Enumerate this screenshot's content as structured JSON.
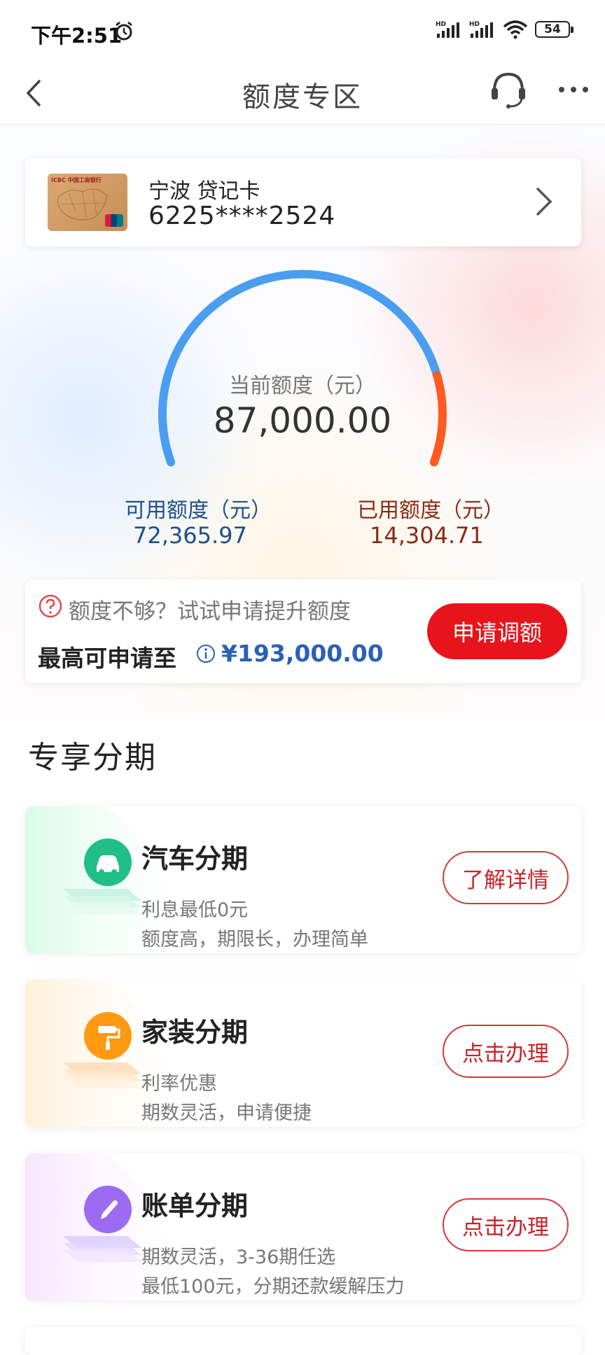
{
  "status_bar": {
    "time": "下午2:51",
    "battery": "54",
    "signal1": "HD",
    "signal2": "HD"
  },
  "nav": {
    "title": "额度专区"
  },
  "card": {
    "name": "宁波 贷记卡",
    "number": "6225****2524",
    "thumb_text": "ICBC 中国工商银行"
  },
  "gauge": {
    "label": "当前额度（元）",
    "total": "87,000.00",
    "available_label": "可用额度（元）",
    "available_value": "72,365.97",
    "used_label": "已用额度（元）",
    "used_value": "14,304.71",
    "used_fraction": 0.1644,
    "color_available": "#4a9ef0",
    "color_used": "#ff5a1f"
  },
  "raise": {
    "hint": "额度不够？试试申请提升额度",
    "max_label": "最高可申请至",
    "max_value": "¥193,000.00",
    "button": "申请调额",
    "button_color": "#e8141b"
  },
  "section_title": "专享分期",
  "promos": [
    {
      "title": "汽车分期",
      "line1": "利息最低0元",
      "line2": "额度高，期限长，办理简单",
      "button": "了解详情",
      "icon": "car-icon",
      "accent": "#1fbf85"
    },
    {
      "title": "家装分期",
      "line1": "利率优惠",
      "line2": "期数灵活，申请便捷",
      "button": "点击办理",
      "icon": "paint-roller-icon",
      "accent": "#ff9a10"
    },
    {
      "title": "账单分期",
      "line1": "期数灵活，3-36期任选",
      "line2": "最低100元，分期还款缓解压力",
      "button": "点击办理",
      "icon": "pen-icon",
      "accent": "#9b6cf2"
    }
  ]
}
